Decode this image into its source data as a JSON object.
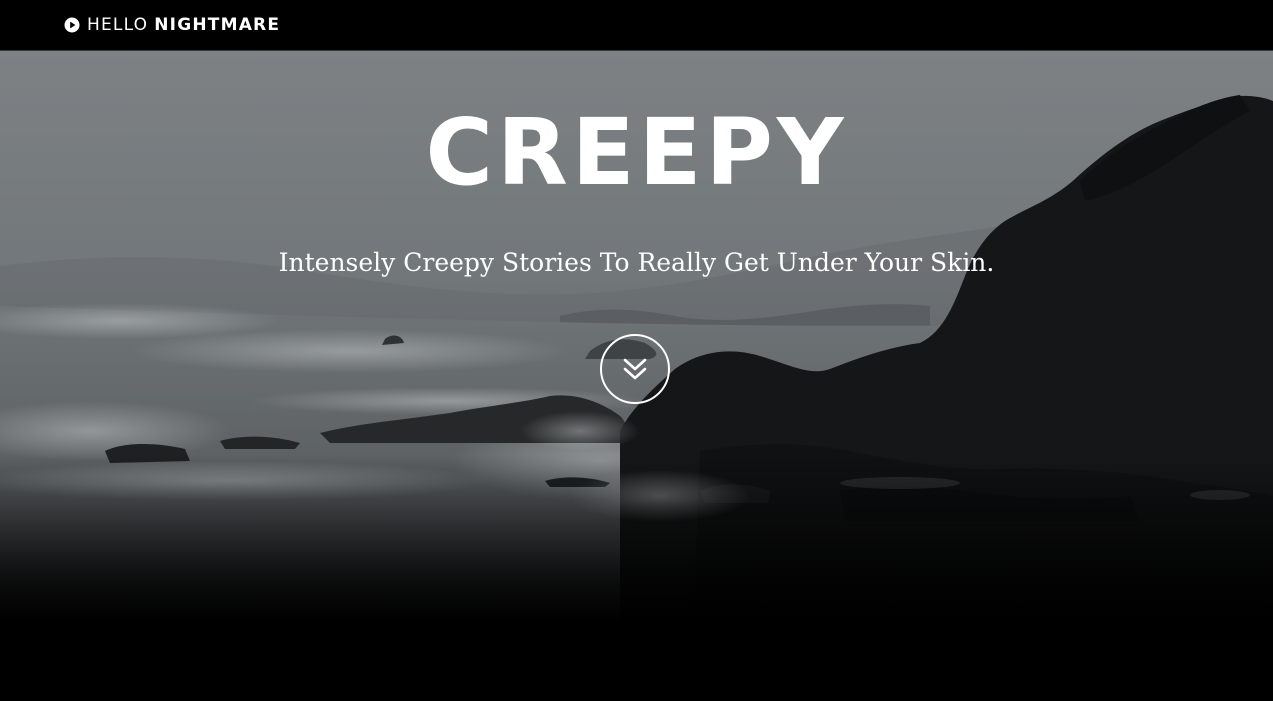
{
  "header": {
    "brand_light": "HELLO",
    "brand_bold": "NIGHTMARE",
    "brand_icon": "play-circle-icon"
  },
  "hero": {
    "title": "CREEPY",
    "subtitle": "Intensely Creepy Stories To Really Get Under Your Skin.",
    "scroll_icon": "double-chevron-down-icon"
  },
  "colors": {
    "background": "#000000",
    "text": "#ffffff",
    "sky": "#7b7f82",
    "rocks": "#151617"
  }
}
